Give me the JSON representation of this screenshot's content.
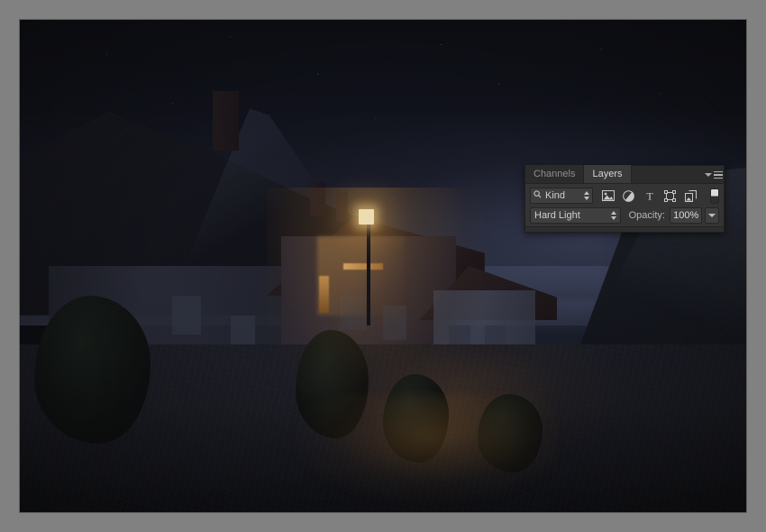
{
  "app": {
    "document_background": "#818181",
    "canvas_border_color": "#818181"
  },
  "photo": {
    "description": "Night photograph of a steep cobbled street lined with stone cottages, a lit street lamp and warm glowing windows, with distant hills under a dark blue sky",
    "accent_lamp_color": "#f2e0b4",
    "warm_glow_color": "#d7983c",
    "sky_color": "#0b0d17",
    "ground_color": "#15161f"
  },
  "panel": {
    "tabs": [
      {
        "label": "Channels",
        "active": false
      },
      {
        "label": "Layers",
        "active": true
      }
    ],
    "menu_icon": "panel-menu-icon",
    "filter_row": {
      "kind": {
        "icon": "search-icon",
        "label": "Kind",
        "stepper_icon": "stepper-updown-icon"
      },
      "filter_icons": [
        {
          "name": "pixel-layer-filter-icon",
          "glyph": "image"
        },
        {
          "name": "adjustment-layer-filter-icon",
          "glyph": "circle-half"
        },
        {
          "name": "type-layer-filter-icon",
          "glyph": "T"
        },
        {
          "name": "shape-layer-filter-icon",
          "glyph": "shape"
        },
        {
          "name": "smart-object-filter-icon",
          "glyph": "smart"
        }
      ],
      "filter_toggle": {
        "name": "filter-enable-toggle",
        "state": "on"
      }
    },
    "blend_row": {
      "blend_mode": "Hard Light",
      "blend_stepper_icon": "stepper-updown-icon",
      "opacity_label": "Opacity:",
      "opacity_value": "100%",
      "opacity_dropdown_icon": "chevron-down-icon"
    }
  }
}
